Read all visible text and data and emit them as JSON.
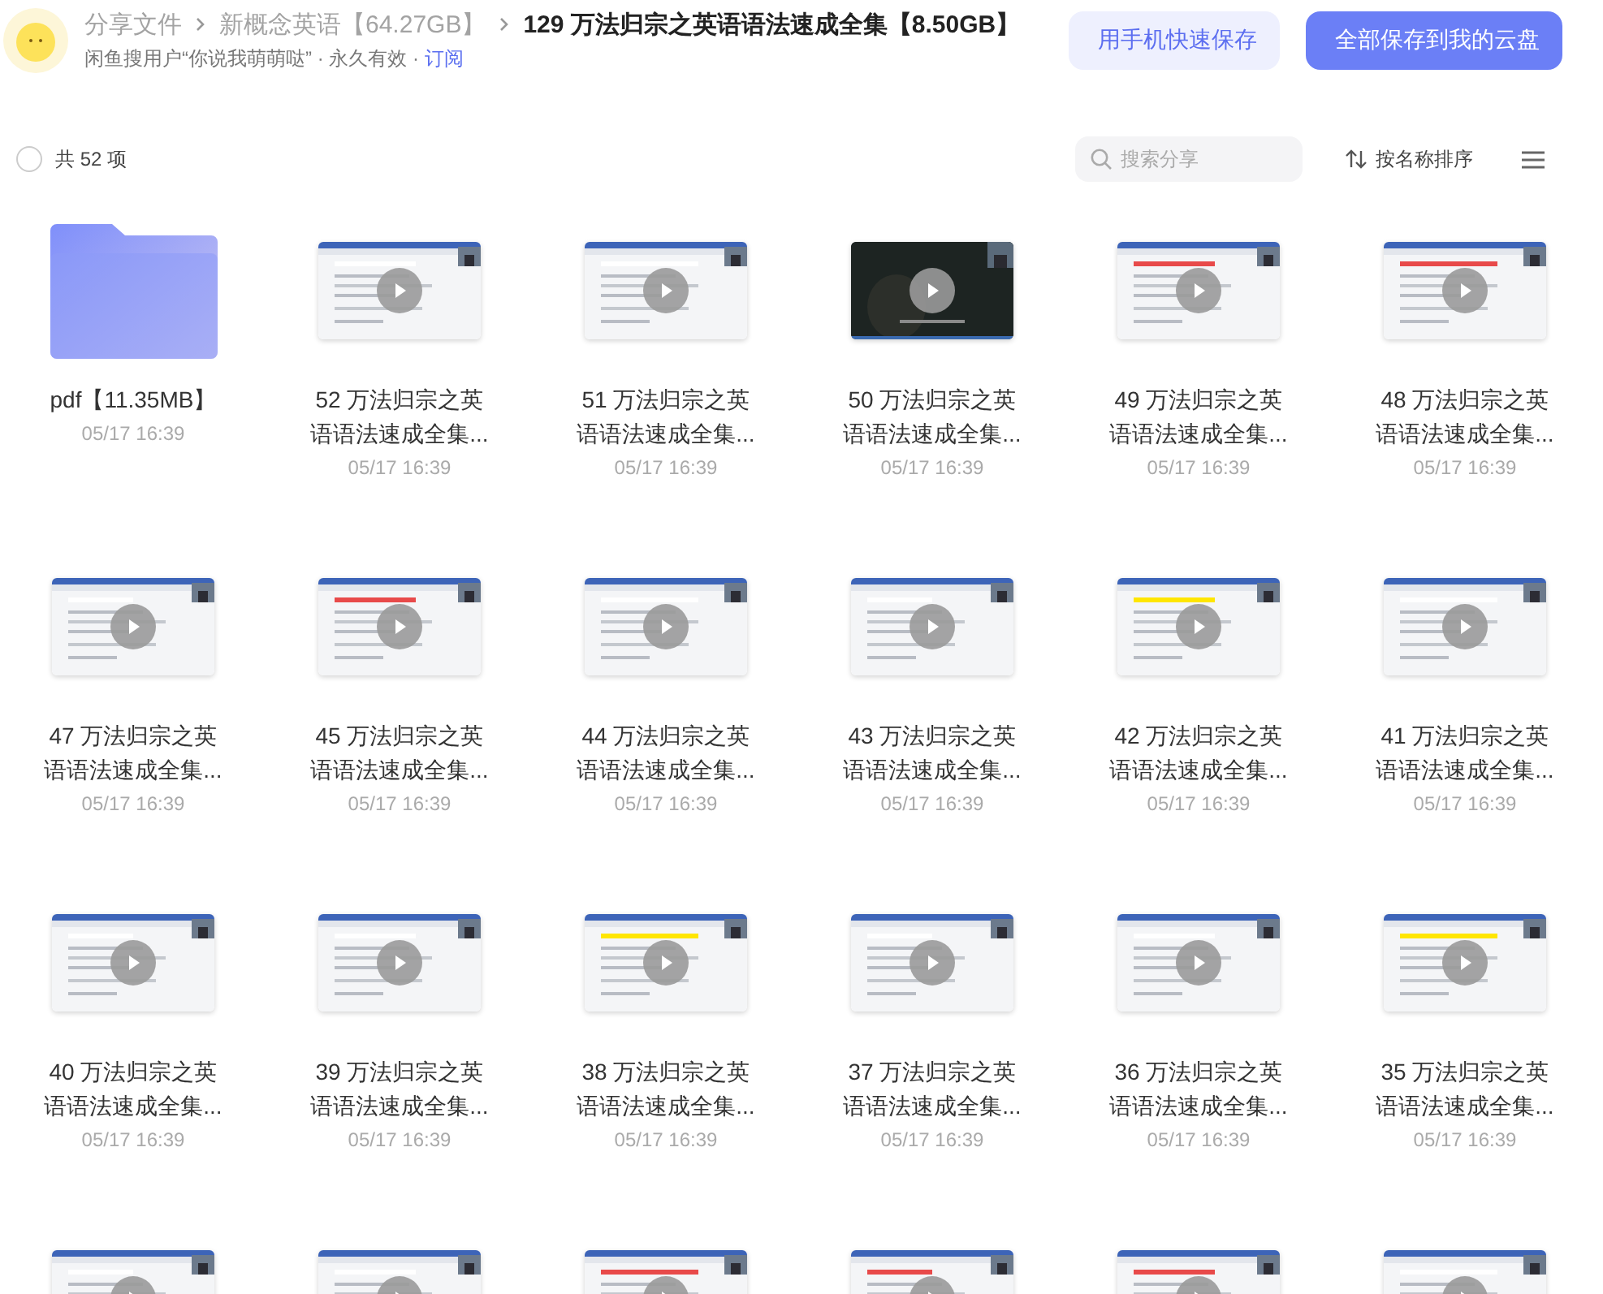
{
  "header": {
    "breadcrumb": [
      {
        "label": "分享文件",
        "current": false
      },
      {
        "label": "新概念英语【64.27GB】",
        "current": false
      },
      {
        "label": "129 万法归宗之英语语法速成全集【8.50GB】",
        "current": true
      }
    ],
    "info": "闲鱼搜用户“你说我萌萌哒” · 永久有效 · ",
    "subscribe_link": "订阅",
    "buttons": [
      {
        "label": "用手机快速保存",
        "kind": "secondary"
      },
      {
        "label": "全部保存到我的云盘",
        "kind": "primary"
      }
    ]
  },
  "toolbar": {
    "select_all": {
      "checked": false
    },
    "count": "共 52 项",
    "search": {
      "placeholder": "搜索分享"
    },
    "sort": "按名称排序"
  },
  "items": [
    {
      "kind": "folder",
      "name": "pdf【11.35MB】",
      "date": "05/17 16:39"
    },
    {
      "kind": "video",
      "name": "52 万法归宗之英语语法速成全集...",
      "date": "05/17 16:39"
    },
    {
      "kind": "video",
      "name": "51 万法归宗之英语语法速成全集...",
      "date": "05/17 16:39"
    },
    {
      "kind": "video",
      "name": "50 万法归宗之英语语法速成全集...",
      "date": "05/17 16:39"
    },
    {
      "kind": "video",
      "name": "49 万法归宗之英语语法速成全集...",
      "date": "05/17 16:39"
    },
    {
      "kind": "video",
      "name": "48 万法归宗之英语语法速成全集...",
      "date": "05/17 16:39"
    },
    {
      "kind": "video",
      "name": "47 万法归宗之英语语法速成全集...",
      "date": "05/17 16:39"
    },
    {
      "kind": "video",
      "name": "45 万法归宗之英语语法速成全集...",
      "date": "05/17 16:39"
    },
    {
      "kind": "video",
      "name": "44 万法归宗之英语语法速成全集...",
      "date": "05/17 16:39"
    },
    {
      "kind": "video",
      "name": "43 万法归宗之英语语法速成全集...",
      "date": "05/17 16:39"
    },
    {
      "kind": "video",
      "name": "42 万法归宗之英语语法速成全集...",
      "date": "05/17 16:39"
    },
    {
      "kind": "video",
      "name": "41 万法归宗之英语语法速成全集...",
      "date": "05/17 16:39"
    },
    {
      "kind": "video",
      "name": "40 万法归宗之英语语法速成全集...",
      "date": "05/17 16:39"
    },
    {
      "kind": "video",
      "name": "39 万法归宗之英语语法速成全集...",
      "date": "05/17 16:39"
    },
    {
      "kind": "video",
      "name": "38 万法归宗之英语语法速成全集...",
      "date": "05/17 16:39"
    },
    {
      "kind": "video",
      "name": "37 万法归宗之英语语法速成全集...",
      "date": "05/17 16:39"
    },
    {
      "kind": "video",
      "name": "36 万法归宗之英语语法速成全集...",
      "date": "05/17 16:39"
    },
    {
      "kind": "video",
      "name": "35 万法归宗之英语语法速成全集...",
      "date": "05/17 16:39"
    },
    {
      "kind": "video"
    },
    {
      "kind": "video"
    },
    {
      "kind": "video"
    },
    {
      "kind": "video"
    },
    {
      "kind": "video"
    },
    {
      "kind": "video"
    }
  ]
}
